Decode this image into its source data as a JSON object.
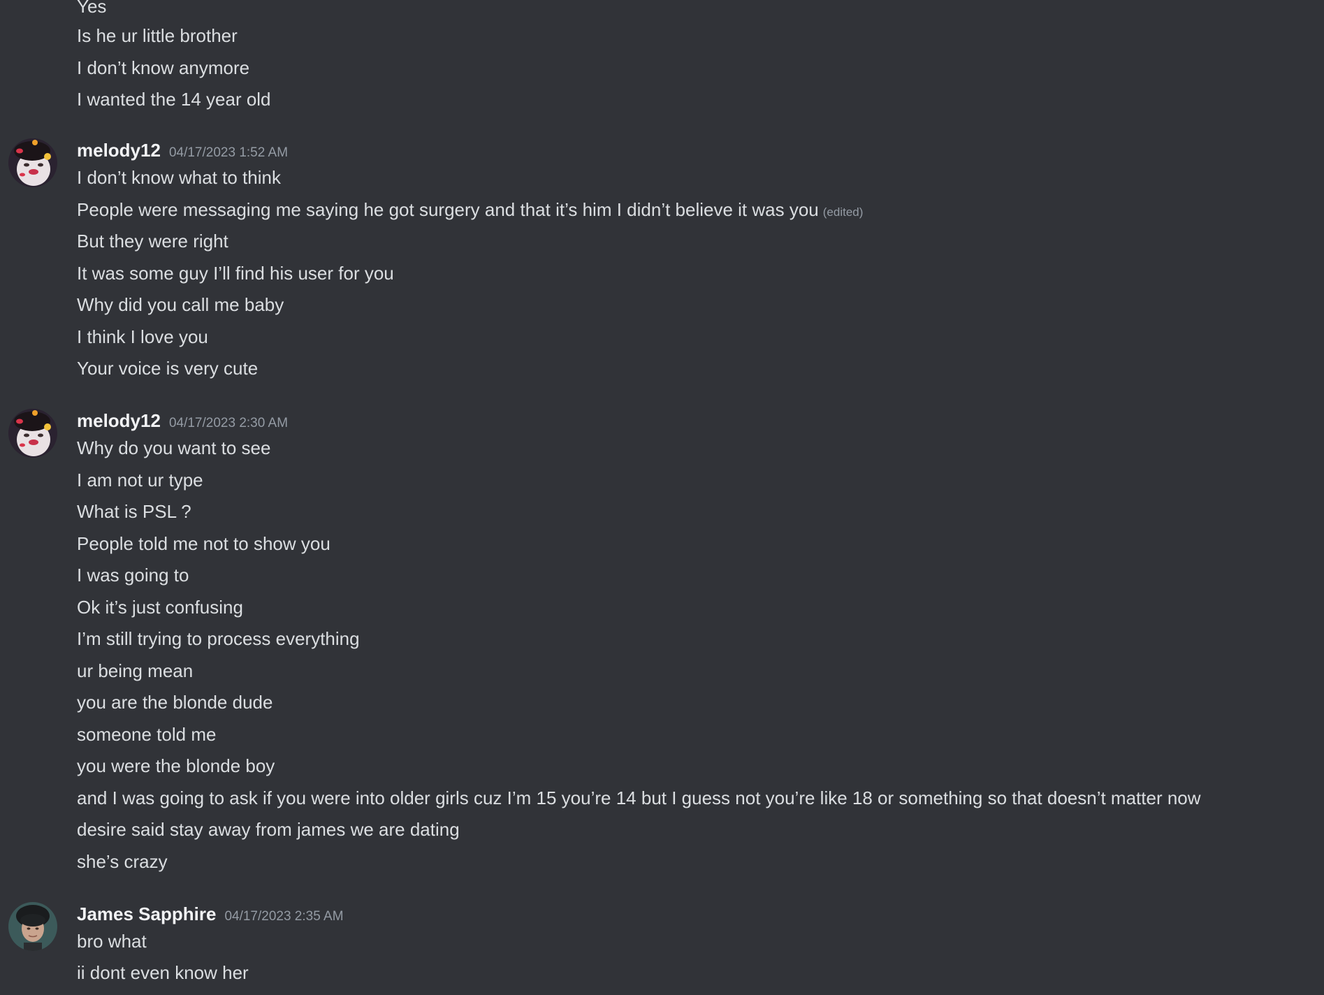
{
  "continuation_lines": [
    "Yes",
    "Is he ur little brother",
    "I don’t know anymore",
    "I wanted the 14 year old"
  ],
  "messages": [
    {
      "username": "melody12",
      "timestamp": "04/17/2023 1:52 AM",
      "avatar_icon": "profile-picture-lips-stickers",
      "lines": [
        "I don’t know what to think",
        "People were messaging me saying he got surgery and that it’s him I didn’t believe it was you",
        "But they were right",
        "It was some guy I’ll find his user for you",
        "Why did you call me baby",
        "I think I love you",
        "Your voice is very cute"
      ],
      "edited_label": "(edited)"
    },
    {
      "username": "melody12",
      "timestamp": "04/17/2023 2:30 AM",
      "avatar_icon": "profile-picture-lips-stickers",
      "lines": [
        "Why do you want to see",
        "I am not ur type",
        "What is PSL ?",
        "People told me not to show you",
        "I was going to",
        "Ok it’s just confusing",
        "I’m still trying to process everything",
        "ur being mean",
        "you are the blonde dude",
        "someone told me",
        "you were the blonde boy",
        "and I was going to ask if you were into older girls cuz I’m 15 you’re 14 but I guess not you’re like 18 or something so that doesn’t matter now",
        "desire said stay away from james we are dating",
        "she’s crazy"
      ]
    },
    {
      "username": "James Sapphire",
      "timestamp": "04/17/2023 2:35 AM",
      "avatar_icon": "profile-picture-person-photo",
      "lines": [
        "bro what",
        "ii dont even know her"
      ]
    }
  ],
  "colors": {
    "background": "#313338",
    "text": "#dbdee1",
    "username": "#f2f3f5",
    "timestamp": "#949ba4"
  }
}
